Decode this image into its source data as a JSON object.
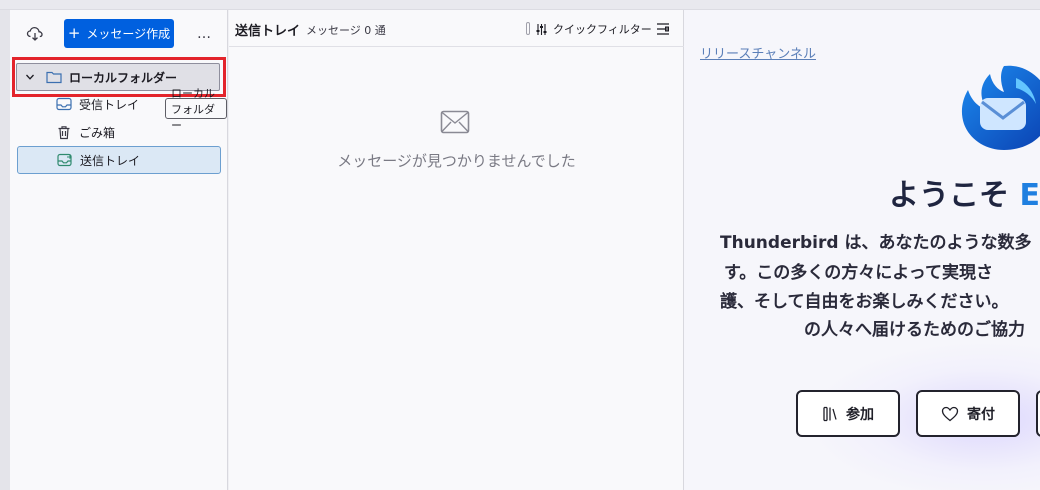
{
  "folder_pane": {
    "compose_label": "メッセージ作成",
    "more_label": "…",
    "root_folder": "ローカルフォルダー",
    "folders": [
      {
        "label": "受信トレイ",
        "icon": "inbox-icon"
      },
      {
        "label": "ごみ箱",
        "icon": "trash-icon"
      },
      {
        "label": "送信トレイ",
        "icon": "outbox-icon"
      }
    ],
    "tooltip": "ローカルフォルダー"
  },
  "message_list": {
    "title": "送信トレイ",
    "count": "メッセージ 0 通",
    "quick_filter_label": "クイックフィルター",
    "empty_text": "メッセージが見つかりませんでした"
  },
  "start_page": {
    "channel_link": "リリースチャンネル",
    "welcome_prefix": "ようこそ",
    "welcome_accent": "E",
    "intro_lines": [
      "Thunderbird は、あなたのような数多",
      "す。この多くの方々によって実現さ",
      "護、そして自由をお楽しみください。",
      "の人々へ届けるためのご協力"
    ],
    "join_label": "参加",
    "donate_label": "寄付"
  },
  "colors": {
    "accent": "#0060df",
    "highlight": "#e3242b",
    "selected_bg": "#dbe8f5"
  }
}
